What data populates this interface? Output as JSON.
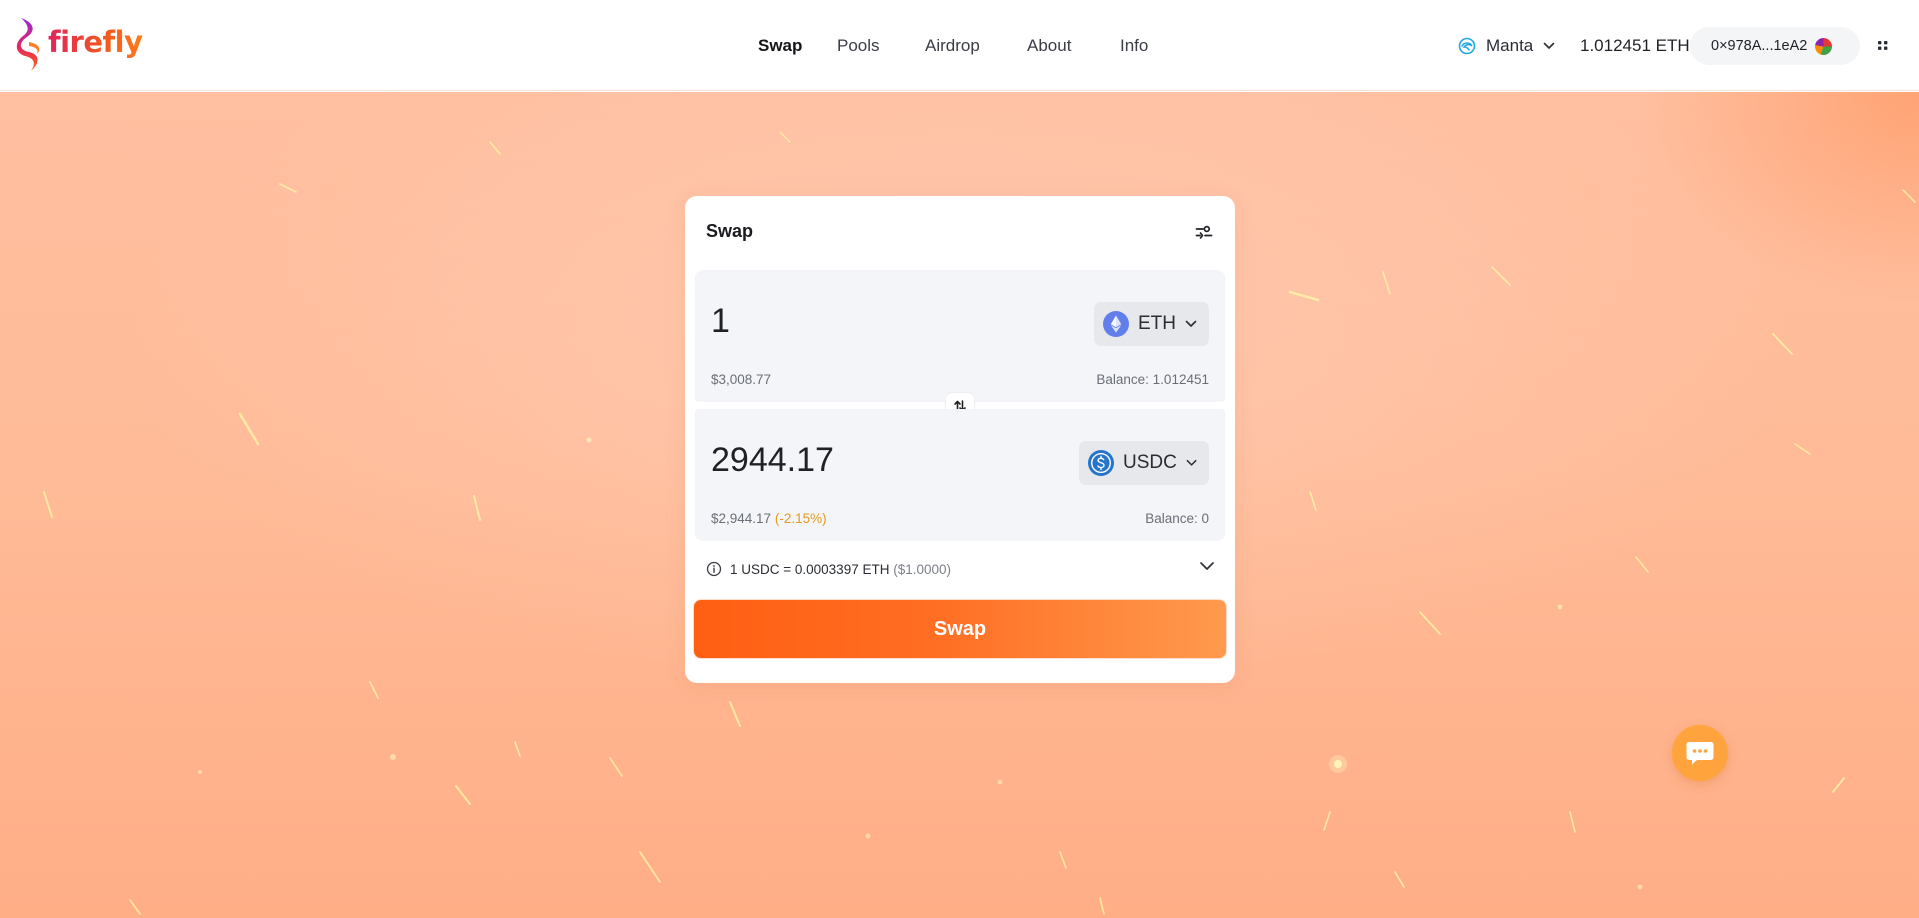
{
  "header": {
    "logo_text": "firefly",
    "nav": [
      {
        "label": "Swap",
        "active": true
      },
      {
        "label": "Pools",
        "active": false
      },
      {
        "label": "Airdrop",
        "active": false
      },
      {
        "label": "About",
        "active": false
      },
      {
        "label": "Info",
        "active": false
      }
    ],
    "network": {
      "label": "Manta",
      "icon": "manta-network-icon"
    },
    "eth_balance": "1.012451 ETH",
    "wallet_address": "0×978A...1eA2"
  },
  "swap": {
    "title": "Swap",
    "from": {
      "amount": "1",
      "token": "ETH",
      "usd_value": "$3,008.77",
      "balance": "Balance: 1.012451"
    },
    "to": {
      "amount": "2944.17",
      "token": "USDC",
      "usd_value": "$2,944.17",
      "usd_change": "(-2.15%)",
      "balance": "Balance: 0"
    },
    "rate": {
      "text": "1 USDC = 0.0003397 ETH",
      "usd": "($1.0000)"
    },
    "button_label": "Swap"
  },
  "colors": {
    "accent": "#ff6a1a",
    "price_impact": "#e39a1e",
    "chat_button": "#ffa43c"
  }
}
